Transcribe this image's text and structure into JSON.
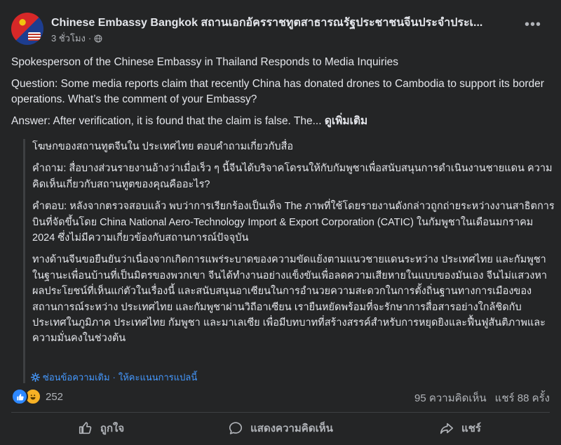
{
  "post": {
    "page_name": "Chinese Embassy Bangkok สถานเอกอัครราชทูตสาธารณรัฐประชาชนจีนประจำประเ...",
    "time_ago": "3 ชั่วโมง",
    "dot": "·",
    "more_label": "•••",
    "paragraphs": [
      "Spokesperson of the Chinese Embassy in Thailand Responds to Media Inquiries",
      "Question: Some media reports claim that recently China has donated drones to Cambodia to support its border operations. What’s the comment of your Embassy?"
    ],
    "answer_text": "Answer: After verification, it is found that the claim is false. The...",
    "see_more": "ดูเพิ่มเติม"
  },
  "translation": {
    "paragraphs": [
      "โฆษกของสถานทูตจีนใน ประเทศไทย ตอบคำถามเกี่ยวกับสื่อ",
      "คำถาม: สื่อบางส่วนรายงานอ้างว่าเมื่อเร็ว ๆ นี้จีนได้บริจาคโดรนให้กับกัมพูชาเพื่อสนับสนุนการดำเนินงานชายแดน ความคิดเห็นเกี่ยวกับสถานทูตของคุณคืออะไร?",
      "คำตอบ: หลังจากตรวจสอบแล้ว พบว่าการเรียกร้องเป็นเท็จ The ภาพที่ใช้โดยรายงานดังกล่าวถูกถ่ายระหว่างงานสาธิตการบินที่จัดขึ้นโดย China National Aero-Technology Import & Export Corporation (CATIC) ในกัมพูชาในเดือนมกราคม 2024 ซึ่งไม่มีความเกี่ยวข้องกับสถานการณ์ปัจจุบัน",
      "ทางด้านจีนขอยืนยันว่าเนื่องจากเกิดการแพร่ระบาดของความขัดแย้งตามแนวชายแดนระหว่าง ประเทศไทย และกัมพูชา ในฐานะเพื่อนบ้านที่เป็นมิตรของพวกเขา จีนได้ทำงานอย่างแข็งขันเพื่อลดความเสียหายในแบบของมันเอง จีนไม่แสวงหาผลประโยชน์ที่เห็นแก่ตัวในเรื่องนี้ และสนับสนุนอาเซียนในการอำนวยความสะดวกในการตั้งถิ่นฐานทางการเมืองของสถานการณ์ระหว่าง ประเทศไทย และกัมพูชาผ่านวิถีอาเซียน เรายืนหยัดพร้อมที่จะรักษาการสื่อสารอย่างใกล้ชิดกับประเทศในภูมิภาค ประเทศไทย กัมพูชา และมาเลเซีย เพื่อมีบทบาทที่สร้างสรรค์สำหรับการหยุดยิงและฟื้นฟูสันติภาพและความมั่นคงในช่วงต้น"
    ],
    "hide_label": "ซ่อนข้อความเดิม",
    "separator": "·",
    "rate_label": "ให้คะแนนการแปลนี้"
  },
  "stats": {
    "reaction_count": "252",
    "comments": "95 ความคิดเห็น",
    "shares": "แชร์ 88 ครั้ง"
  },
  "actions": {
    "like": "ถูกใจ",
    "comment": "แสดงความคิดเห็น",
    "share": "แชร์"
  },
  "colors": {
    "background": "#242526",
    "text": "#e4e6eb",
    "secondary": "#b0b3b8",
    "link": "#4599ff",
    "like_blue": "#2d88ff"
  }
}
